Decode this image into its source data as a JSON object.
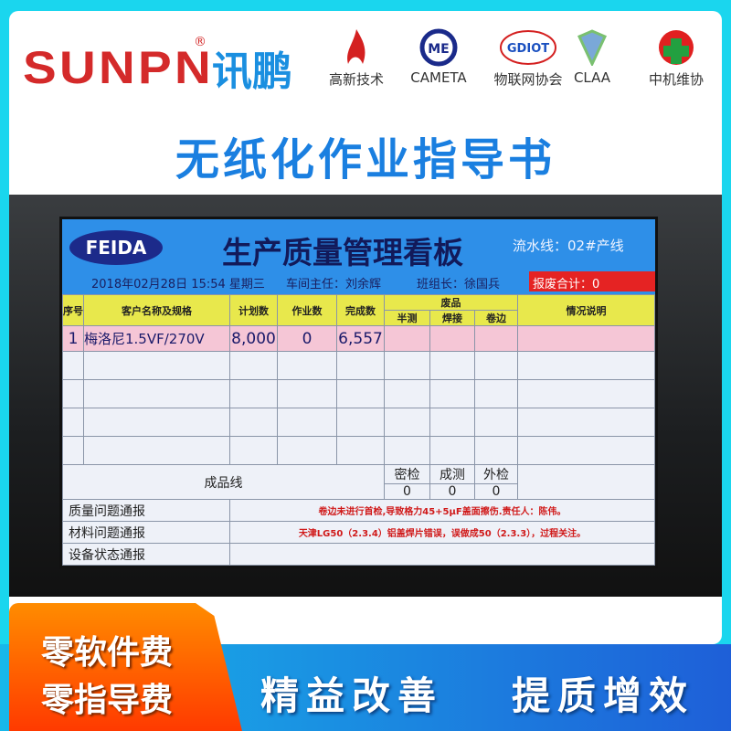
{
  "brand": {
    "logo_latin": "SUNPN",
    "registered": "®",
    "logo_cn": "讯鹏"
  },
  "partners": [
    {
      "label": "高新技术",
      "icon": "flame-logo-icon"
    },
    {
      "label": "CAMETA",
      "icon": "cameta-logo-icon"
    },
    {
      "label": "物联网协会",
      "icon": "gdiot-logo-icon",
      "logo_text": "GDIOT"
    },
    {
      "label": "CLAA",
      "icon": "claa-diamond-icon"
    },
    {
      "label": "中机维协",
      "icon": "gear-cross-icon"
    }
  ],
  "title": "无纸化作业指导书",
  "board": {
    "logo": "FEIDA",
    "title": "生产质量管理看板",
    "line": "流水线：02#产线",
    "datetime": "2018年02月28日 15:54 星期三",
    "manager": "车间主任：刘余辉",
    "leader": "班组长：徐国兵",
    "scrap_total": "报废合计：0",
    "headers": {
      "no": "序号",
      "customer": "客户名称及规格",
      "plan": "计划数",
      "work": "作业数",
      "done": "完成数",
      "waste": "废品",
      "half": "半测",
      "weld": "焊接",
      "curl": "卷边",
      "remark": "情况说明"
    },
    "rows": [
      {
        "no": "1",
        "customer": "梅洛尼1.5VF/270V",
        "plan": "8,000",
        "work": "0",
        "done": "6,557"
      }
    ],
    "finished": {
      "label": "成品线",
      "cols": [
        "密检",
        "成测",
        "外检"
      ],
      "values": [
        "0",
        "0",
        "0"
      ]
    },
    "notices": [
      {
        "label": "质量问题通报",
        "text": "卷边未进行首检,导致格力45+5μF盖面擦伤.责任人：陈伟。"
      },
      {
        "label": "材料问题通报",
        "text": "天津LG50（2.3.4）铝盖焊片错误，误做成50（2.3.3），过程关注。"
      },
      {
        "label": "设备状态通报",
        "text": ""
      }
    ]
  },
  "promo": {
    "left": [
      "零软件费",
      "零指导费"
    ],
    "right": [
      "精益改善",
      "提质增效"
    ]
  },
  "colors": {
    "frame": "#1ad6ee",
    "title": "#1a7fe0",
    "orange": "#ff5a00",
    "board_header": "#2e8fe8",
    "scrap": "#e52323"
  }
}
